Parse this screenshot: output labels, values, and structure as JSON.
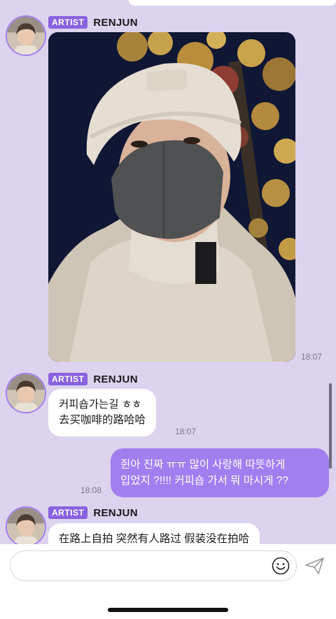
{
  "theme": {
    "background": "#dcd3ee",
    "accent": "#a27ff0",
    "badge": "#8a62e0",
    "incoming_bubble": "#ffffff"
  },
  "messages": [
    {
      "sender_badge": "ARTIST",
      "sender_name": "RENJUN",
      "avatar_icon": "artist-avatar",
      "content_type": "photo",
      "photo_subject": "selfie-knit-beanie-black-mask",
      "time": "18:07"
    },
    {
      "sender_badge": "ARTIST",
      "sender_name": "RENJUN",
      "avatar_icon": "artist-avatar",
      "lines": [
        "커피숍가는길 ㅎㅎ",
        "去买咖啡的路哈哈"
      ],
      "time": "18:07"
    },
    {
      "direction": "outgoing",
      "lines": [
        "쥔아 진짜 ㅠㅠ 많이 사랑해 따뜻하게",
        "입었지 ?!!!! 커피숍 가서 뭐 마시게 ??"
      ],
      "time": "18:08"
    },
    {
      "sender_badge": "ARTIST",
      "sender_name": "RENJUN",
      "avatar_icon": "artist-avatar",
      "lines": [
        "在路上自拍 突然有人路过 假装没在拍哈"
      ]
    }
  ],
  "composer": {
    "placeholder": "",
    "emoji_icon": "smiley-icon",
    "send_icon": "send-paper-plane-icon"
  }
}
